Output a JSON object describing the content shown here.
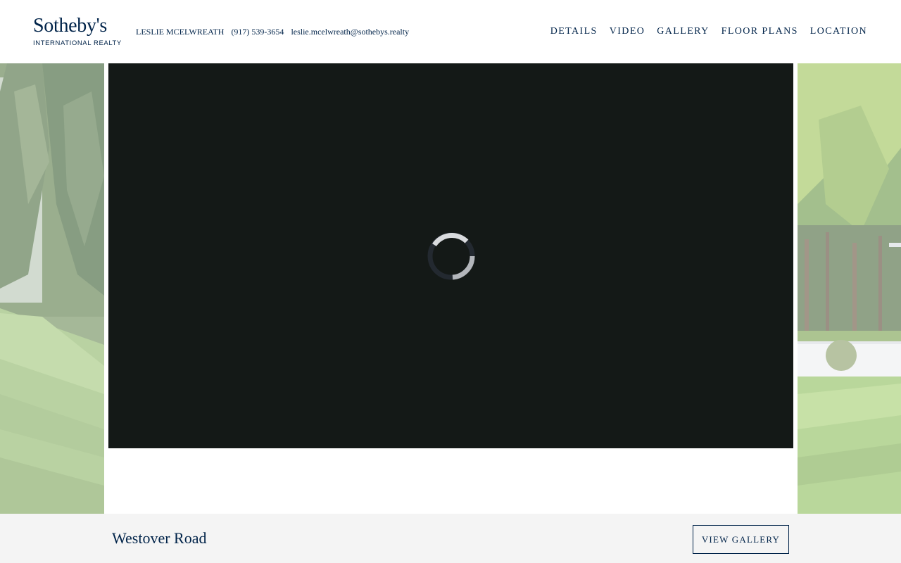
{
  "brand": {
    "name": "Sotheby's",
    "subtitle": "INTERNATIONAL REALTY",
    "color": "#002349"
  },
  "agent": {
    "name": "LESLIE MCELWREATH",
    "phone": "(917) 539-3654",
    "email": "leslie.mcelwreath@sothebys.realty"
  },
  "nav": {
    "items": [
      {
        "label": "DETAILS"
      },
      {
        "label": "VIDEO"
      },
      {
        "label": "GALLERY"
      },
      {
        "label": "FLOOR PLANS"
      },
      {
        "label": "LOCATION"
      }
    ]
  },
  "video": {
    "state": "loading",
    "icon": "loading-spinner-icon",
    "background": "#141917"
  },
  "property": {
    "title": "Westover Road"
  },
  "footer": {
    "gallery_button": "VIEW GALLERY",
    "background": "#f4f4f4"
  }
}
